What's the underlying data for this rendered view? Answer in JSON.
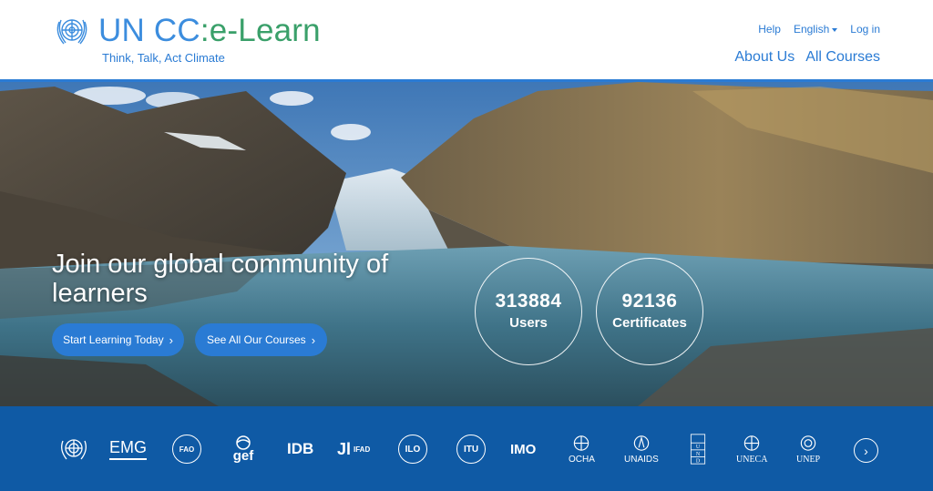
{
  "brand": {
    "name_part1": "UN CC",
    "name_sep": ":",
    "name_part2": "e-Learn",
    "tagline": "Think, Talk, Act Climate"
  },
  "top_links": {
    "help": "Help",
    "language": "English",
    "login": "Log in"
  },
  "main_nav": {
    "about": "About Us",
    "courses": "All Courses"
  },
  "hero": {
    "title": "Join our global community of learners",
    "buttons": [
      {
        "label": "Start Learning Today"
      },
      {
        "label": "See All Our Courses"
      }
    ],
    "stats": [
      {
        "value": "313884",
        "label": "Users"
      },
      {
        "value": "92136",
        "label": "Certificates"
      }
    ]
  },
  "partners": [
    {
      "name": "UN",
      "icon": "un-emblem-icon"
    },
    {
      "name": "EMG",
      "icon": "emg-logo-icon"
    },
    {
      "name": "FAO",
      "icon": "fao-logo-icon"
    },
    {
      "name": "gef",
      "icon": "gef-logo-icon"
    },
    {
      "name": "IDB",
      "icon": "idb-logo-icon"
    },
    {
      "name": "IFAD",
      "icon": "ifad-logo-icon"
    },
    {
      "name": "ILO",
      "icon": "ilo-logo-icon"
    },
    {
      "name": "ITU",
      "icon": "itu-logo-icon"
    },
    {
      "name": "IMO",
      "icon": "imo-logo-icon"
    },
    {
      "name": "OCHA",
      "icon": "ocha-logo-icon"
    },
    {
      "name": "UNAIDS",
      "icon": "unaids-logo-icon"
    },
    {
      "name": "UNDP",
      "icon": "undp-logo-icon"
    },
    {
      "name": "UNECA",
      "icon": "uneca-logo-icon"
    },
    {
      "name": "UNEP",
      "icon": "unep-logo-icon"
    }
  ],
  "colors": {
    "brand_blue": "#2a7bd4",
    "brand_green": "#3aa06a",
    "partners_bar": "#0f5aa5"
  }
}
